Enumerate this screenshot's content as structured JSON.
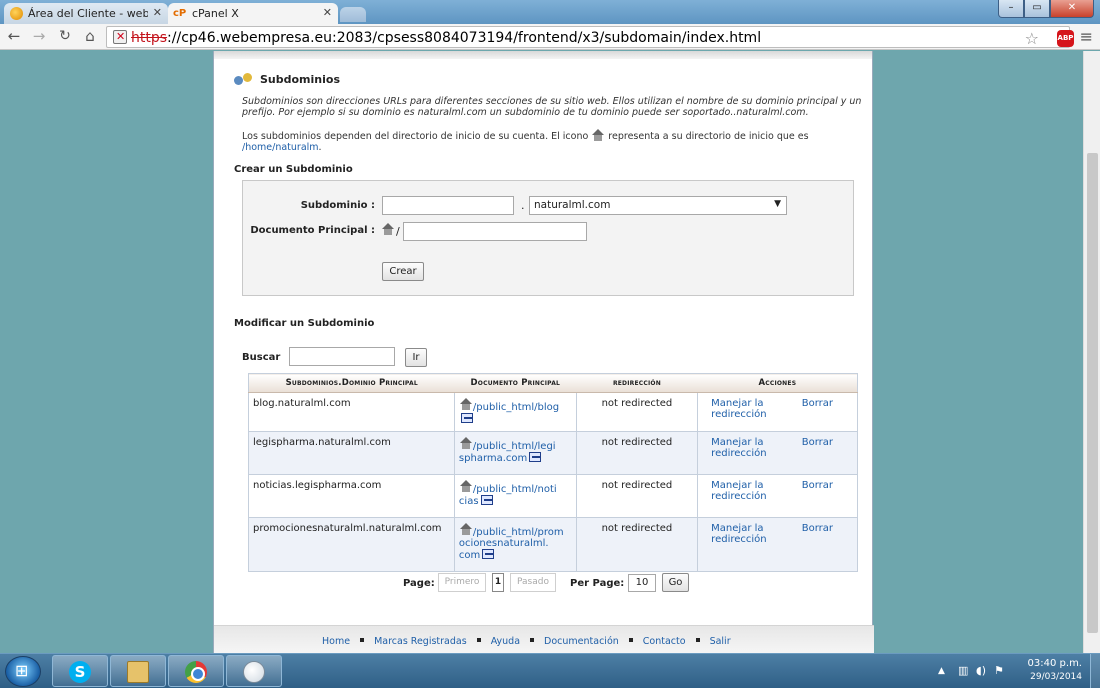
{
  "browser": {
    "tabs": [
      {
        "title": "Área del Cliente - webemp"
      },
      {
        "title": "cPanel X",
        "icon_text": "cP"
      }
    ],
    "url_scheme": "https",
    "url_rest": "://cp46.webempresa.eu:2083/cpsess8084073194/frontend/x3/subdomain/index.html",
    "abp_label": "ABP"
  },
  "page": {
    "title": "Subdominios",
    "intro_italic": "Subdominios son direcciones URLs para diferentes secciones de su sitio web. Ellos utilizan el nombre de su dominio principal y un prefijo. Por ejemplo si su dominio es naturalml.com un subdominio de tu dominio puede ser soportado..naturalml.com.",
    "intro2_before": "Los subdominios dependen del directorio de inicio de su cuenta. El icono",
    "intro2_after": "representa a su directorio de inicio que es",
    "home_path": "/home/naturalm",
    "intro2_end": "."
  },
  "create": {
    "heading": "Crear un Subdominio",
    "subdomain_label": "Subdominio :",
    "subdomain_value": "",
    "dot": ".",
    "domain_selected": "naturalml.com",
    "docroot_label": "Documento Principal :",
    "docroot_slash": "/",
    "docroot_value": "",
    "create_button": "Crear"
  },
  "modify": {
    "heading": "Modificar un Subdominio",
    "search_label": "Buscar",
    "search_value": "",
    "search_button": "Ir",
    "columns": {
      "domain": "Subdominios.Dominio Principal",
      "doc": "Documento Principal",
      "redirect": "redirección",
      "actions": "Acciones"
    },
    "rows": [
      {
        "domain": "blog.naturalml.com",
        "doc_line1": "/public_html/blog",
        "doc_line2": "",
        "doc_line3": "",
        "redirect": "not redirected",
        "manage": "Manejar la redirección",
        "remove": "Borrar"
      },
      {
        "domain": "legispharma.naturalml.com",
        "doc_line1": "/public_html/legi",
        "doc_line2": "spharma.com",
        "doc_line3": "",
        "redirect": "not redirected",
        "manage": "Manejar la redirección",
        "remove": "Borrar"
      },
      {
        "domain": "noticias.legispharma.com",
        "doc_line1": "/public_html/noti",
        "doc_line2": "cias",
        "doc_line3": "",
        "redirect": "not redirected",
        "manage": "Manejar la redirección",
        "remove": "Borrar"
      },
      {
        "domain": "promocionesnaturalml.naturalml.com",
        "doc_line1": "/public_html/prom",
        "doc_line2": "ocionesnaturalml.",
        "doc_line3": "com",
        "redirect": "not redirected",
        "manage": "Manejar la redirección",
        "remove": "Borrar"
      }
    ],
    "pager": {
      "page_label": "Page:",
      "first": "Primero",
      "current": "1",
      "prev": "Pasado",
      "perpage_label": "Per Page:",
      "perpage_value": "10",
      "go": "Go"
    }
  },
  "footer": {
    "links": [
      "Home",
      "Marcas Registradas",
      "Ayuda",
      "Documentación",
      "Contacto",
      "Salir"
    ]
  },
  "taskbar": {
    "time": "03:40 p.m.",
    "date": "29/03/2014"
  }
}
